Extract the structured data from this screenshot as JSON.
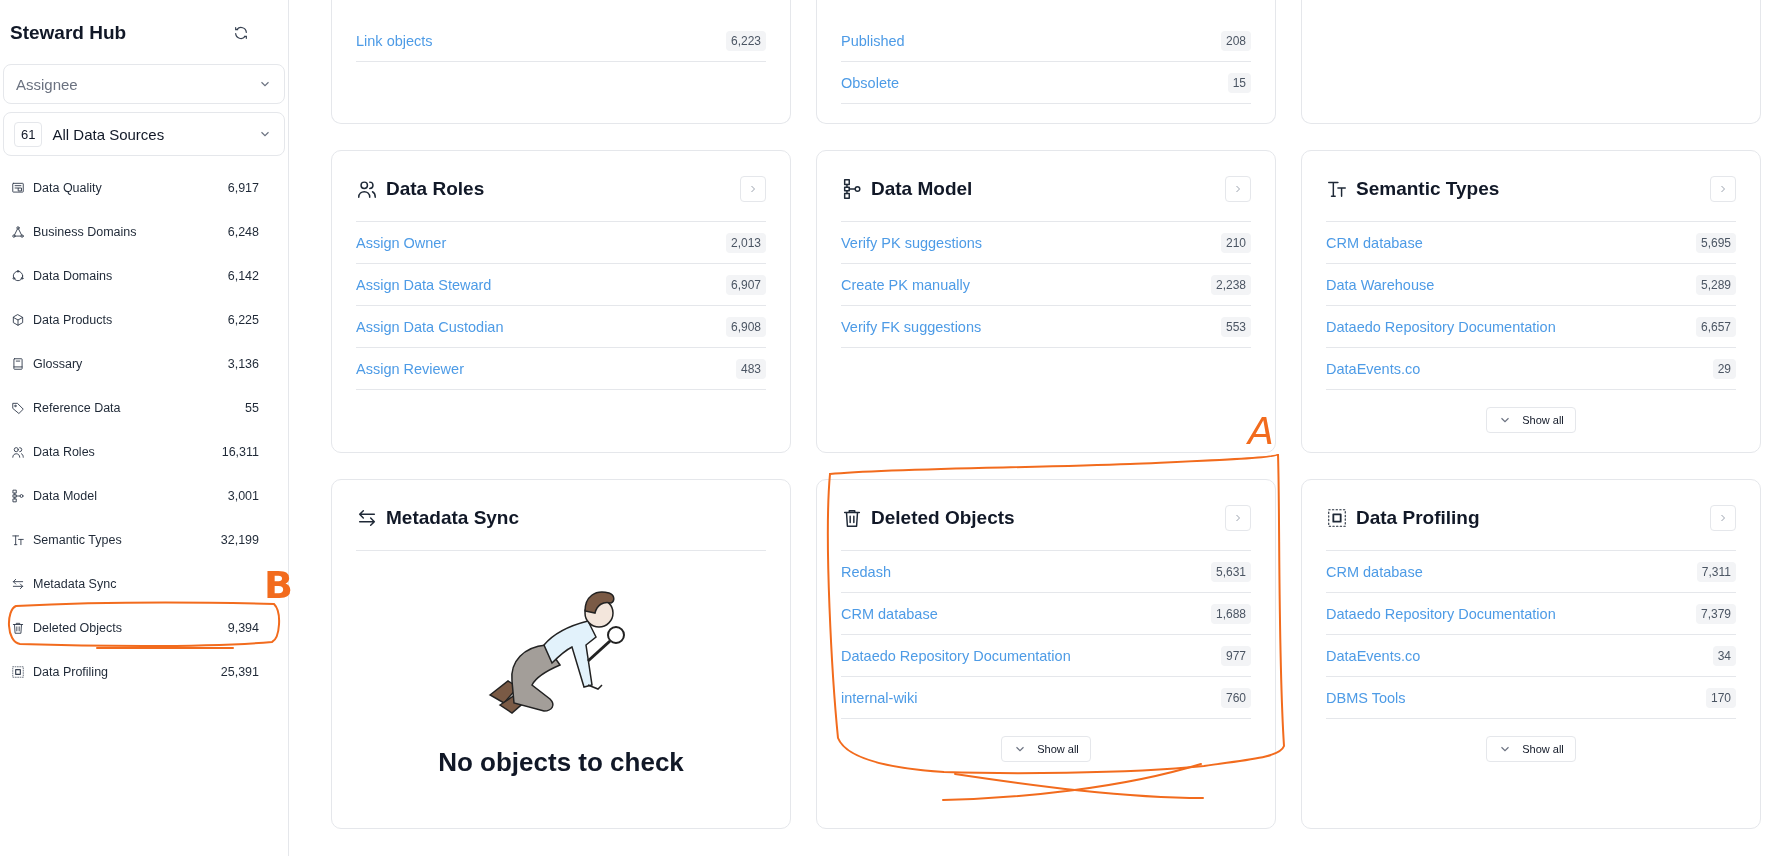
{
  "sidebar": {
    "title": "Steward Hub",
    "assignee": {
      "placeholder": "Assignee"
    },
    "source_filter": {
      "count": "61",
      "label": "All Data Sources"
    },
    "items": [
      {
        "label": "Data Quality",
        "count": "6,917"
      },
      {
        "label": "Business Domains",
        "count": "6,248"
      },
      {
        "label": "Data Domains",
        "count": "6,142"
      },
      {
        "label": "Data Products",
        "count": "6,225"
      },
      {
        "label": "Glossary",
        "count": "3,136"
      },
      {
        "label": "Reference Data",
        "count": "55"
      },
      {
        "label": "Data Roles",
        "count": "16,311"
      },
      {
        "label": "Data Model",
        "count": "3,001"
      },
      {
        "label": "Semantic Types",
        "count": "32,199"
      },
      {
        "label": "Metadata Sync"
      },
      {
        "label": "Deleted Objects",
        "count": "9,394"
      },
      {
        "label": "Data Profiling",
        "count": "25,391"
      }
    ]
  },
  "cards": [
    {
      "kind": "list",
      "rows": [
        {
          "label": "Link objects",
          "count": "6,223"
        }
      ]
    },
    {
      "kind": "list",
      "rows": [
        {
          "label": "Published",
          "count": "208"
        },
        {
          "label": "Obsolete",
          "count": "15"
        }
      ]
    },
    {
      "kind": "list"
    },
    {
      "kind": "list",
      "title": "Data Roles",
      "rows": [
        {
          "label": "Assign Owner",
          "count": "2,013"
        },
        {
          "label": "Assign Data Steward",
          "count": "6,907"
        },
        {
          "label": "Assign Data Custodian",
          "count": "6,908"
        },
        {
          "label": "Assign Reviewer",
          "count": "483"
        }
      ]
    },
    {
      "kind": "list",
      "title": "Data Model",
      "rows": [
        {
          "label": "Verify PK suggestions",
          "count": "210"
        },
        {
          "label": "Create PK manually",
          "count": "2,238"
        },
        {
          "label": "Verify FK suggestions",
          "count": "553"
        }
      ]
    },
    {
      "kind": "list",
      "title": "Semantic Types",
      "rows": [
        {
          "label": "CRM database",
          "count": "5,695"
        },
        {
          "label": "Data Warehouse",
          "count": "5,289"
        },
        {
          "label": "Dataedo Repository Documentation",
          "count": "6,657"
        },
        {
          "label": "DataEvents.co",
          "count": "29"
        }
      ],
      "show_all": "Show all"
    },
    {
      "kind": "empty",
      "title": "Metadata Sync",
      "message": "No objects to check"
    },
    {
      "kind": "list",
      "title": "Deleted Objects",
      "rows": [
        {
          "label": "Redash",
          "count": "5,631"
        },
        {
          "label": "CRM database",
          "count": "1,688"
        },
        {
          "label": "Dataedo Repository Documentation",
          "count": "977"
        },
        {
          "label": "internal-wiki",
          "count": "760"
        }
      ],
      "show_all": "Show all"
    },
    {
      "kind": "list",
      "title": "Data Profiling",
      "rows": [
        {
          "label": "CRM database",
          "count": "7,311"
        },
        {
          "label": "Dataedo Repository Documentation",
          "count": "7,379"
        },
        {
          "label": "DataEvents.co",
          "count": "34"
        },
        {
          "label": "DBMS Tools",
          "count": "170"
        }
      ],
      "show_all": "Show all"
    }
  ],
  "annotations": [
    {
      "label": "A"
    },
    {
      "label": "B"
    }
  ]
}
